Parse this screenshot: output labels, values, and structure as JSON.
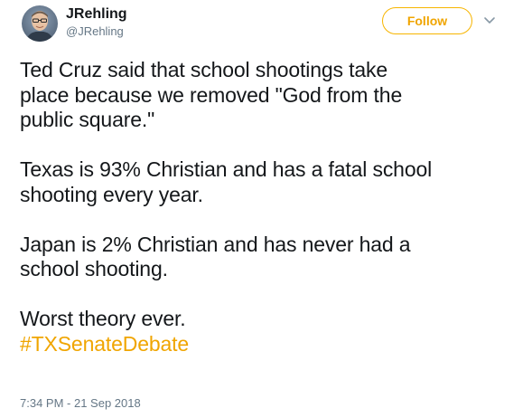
{
  "header": {
    "display_name": "JRehling",
    "handle": "@JRehling",
    "follow_label": "Follow",
    "avatar_icon": "user-avatar-photo",
    "chevron_icon": "chevron-down-icon"
  },
  "tweet": {
    "paragraphs": [
      {
        "lines": [
          "Ted Cruz said that school shootings take",
          "place because we removed \"God from the",
          "public square.\""
        ]
      },
      {
        "lines": [
          "Texas is 93% Christian and has a fatal school",
          "shooting every year."
        ]
      },
      {
        "lines": [
          "Japan is 2% Christian and has never had a",
          "school shooting."
        ]
      }
    ],
    "closing_line": "Worst theory ever.",
    "hashtag": "#TXSenateDebate",
    "timestamp": "7:34 PM - 21 Sep 2018"
  },
  "colors": {
    "accent": "#f0a500",
    "text": "#14171a",
    "muted": "#657786"
  }
}
